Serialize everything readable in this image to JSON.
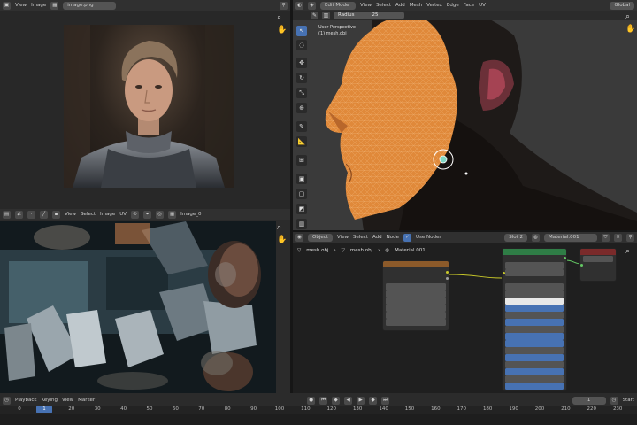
{
  "image_editor": {
    "header": {
      "view": "View",
      "image": "Image",
      "filename": "image.png"
    }
  },
  "uv_editor": {
    "header": {
      "view": "View",
      "select": "Select",
      "image": "Image",
      "uv": "UV",
      "filename": "Image_0"
    }
  },
  "viewport": {
    "header": {
      "mode": "Edit Mode",
      "view": "View",
      "select": "Select",
      "add": "Add",
      "mesh": "Mesh",
      "vertex": "Vertex",
      "edge": "Edge",
      "face": "Face",
      "uv": "UV",
      "orientation": "Global",
      "radius_label": "Radius",
      "radius_value": "25"
    },
    "overlay_title": "User Perspective",
    "overlay_object": "(1) mesh.obj"
  },
  "node_editor": {
    "header": {
      "object": "Object",
      "view": "View",
      "select": "Select",
      "add": "Add",
      "node": "Node",
      "use_nodes": "Use Nodes",
      "slot": "Slot 2",
      "material": "Material.001"
    },
    "breadcrumb": {
      "object": "mesh.obj",
      "mesh": "mesh.obj",
      "material": "Material.001"
    }
  },
  "timeline": {
    "header": {
      "playback": "Playback",
      "keying": "Keying",
      "view": "View",
      "marker": "Marker",
      "current_frame": "1",
      "start_label": "Start"
    },
    "ticks": [
      "0",
      "10",
      "20",
      "30",
      "40",
      "50",
      "60",
      "70",
      "80",
      "90",
      "100",
      "110",
      "120",
      "130",
      "140",
      "150",
      "160",
      "170",
      "180",
      "190",
      "200",
      "210",
      "220",
      "230"
    ]
  },
  "colors": {
    "accent": "#4772b3",
    "selection": "#e8862a",
    "shader_header": "#2f7d46",
    "image_node": "#8c5a2a"
  }
}
